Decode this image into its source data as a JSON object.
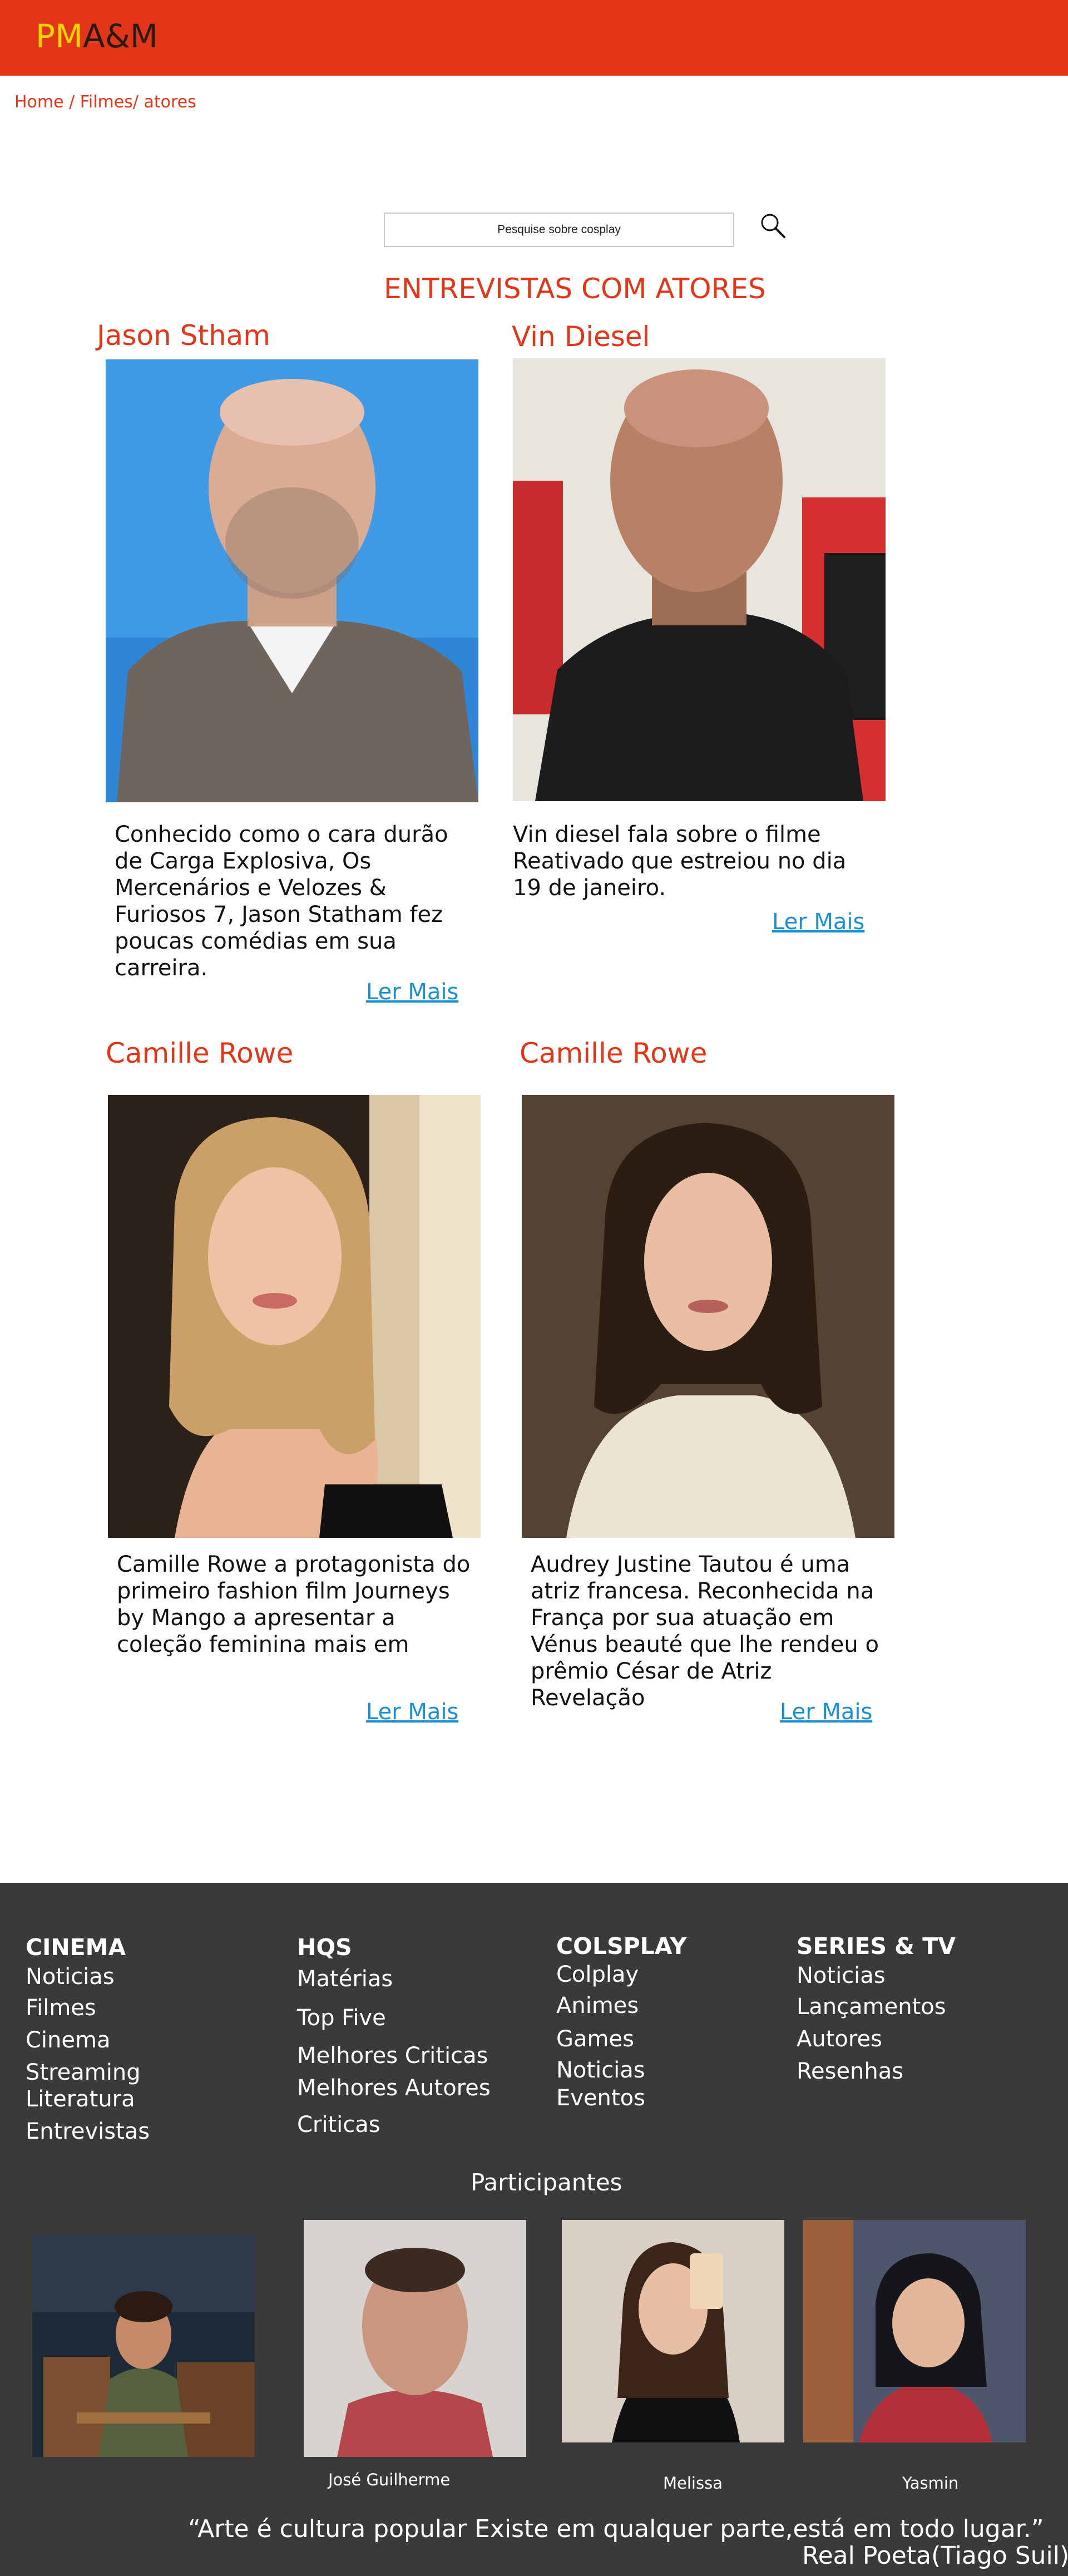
{
  "header": {
    "logo_pm": "PM",
    "logo_am": "A&M",
    "brand_color": "#e33618"
  },
  "breadcrumb": {
    "home": "Home",
    "sep1": " / ",
    "filmes": "Filmes",
    "sep2": "/ ",
    "atores": "atores"
  },
  "search": {
    "placeholder": "Pesquise sobre cosplay",
    "icon": "search-icon"
  },
  "section_title": "ENTREVISTAS COM ATORES",
  "actors": [
    {
      "name": "Jason Stham",
      "description": "Conhecido como o cara durão de Carga Explosiva, Os Mercenários e Velozes & Furiosos 7, Jason Statham fez poucas comédias em sua carreira.",
      "more": "Ler Mais"
    },
    {
      "name": "Vin Diesel",
      "description": "Vin diesel fala sobre o filme Reativado que estreiou no dia 19 de janeiro.",
      "more": "Ler Mais"
    },
    {
      "name": "Camille Rowe",
      "description": "Camille Rowe a protagonista do primeiro fashion film Journeys by Mango a apresentar a coleção feminina mais em",
      "more": "Ler Mais"
    },
    {
      "name": "Camille Rowe",
      "description": "Audrey Justine Tautou é uma atriz francesa. Reconhecida na França por sua atuação em Vénus beauté que lhe rendeu o prêmio César de Atriz Revelação",
      "more": "Ler Mais"
    }
  ],
  "footer": {
    "columns": [
      {
        "heading": "CINEMA",
        "links": [
          "Noticias",
          "Filmes",
          "Cinema",
          "Streaming",
          "Literatura",
          "Entrevistas"
        ]
      },
      {
        "heading": "HQS",
        "links": [
          "Matérias",
          "Top Five",
          "Melhores Criticas",
          "Melhores Autores",
          "Criticas"
        ]
      },
      {
        "heading": "COLSPLAY",
        "links": [
          "Colplay",
          "Animes",
          "Games",
          "Noticias",
          "Eventos"
        ]
      },
      {
        "heading": "SERIES & TV",
        "links": [
          "Noticias",
          "Lançamentos",
          "Autores",
          "Resenhas"
        ]
      }
    ],
    "participants_title": "Participantes",
    "participants": [
      "José Guilherme",
      "Melissa",
      "Yasmin"
    ],
    "quote": "“Arte é cultura popular Existe em qualquer parte,está em todo lugar.”",
    "quote_author": "Real Poeta(Tiago Suil)",
    "background": "#3a3a3a"
  }
}
